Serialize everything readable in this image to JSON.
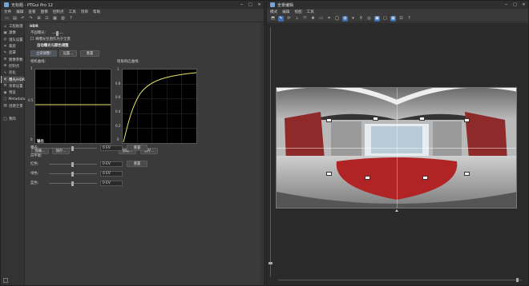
{
  "left_window": {
    "title": "无标题 - PTGui Pro 12",
    "menu": [
      "文件",
      "编辑",
      "查看",
      "图像",
      "控制点",
      "工具",
      "项目",
      "帮助"
    ],
    "sidebar": [
      {
        "label": "工程助理",
        "icon": "assistant-icon"
      },
      {
        "label": "源像",
        "icon": "source-images-icon"
      },
      {
        "label": "镜头设置",
        "icon": "lens-settings-icon"
      },
      {
        "label": "裁剪",
        "icon": "crop-icon"
      },
      {
        "label": "遮罩",
        "icon": "mask-icon"
      },
      {
        "label": "图像参数",
        "icon": "image-parameters-icon"
      },
      {
        "label": "控制点",
        "icon": "control-points-icon"
      },
      {
        "label": "优化",
        "icon": "optimizer-icon"
      },
      {
        "label": "曝光/HDR",
        "icon": "exposure-hdr-icon"
      },
      {
        "label": "项目设置",
        "icon": "project-settings-icon"
      },
      {
        "label": "预览",
        "icon": "preview-icon"
      },
      {
        "label": "Metadata",
        "icon": "metadata-icon"
      },
      {
        "label": "创建全景",
        "icon": "create-panorama-icon"
      },
      {
        "label": "",
        "icon": ""
      },
      {
        "label": "我的",
        "icon": "user-icon"
      }
    ],
    "hdr": {
      "section_title": "HDR",
      "bracket_label": "不固曝光:",
      "true_hdr_label": "将曝光包围作为于全景",
      "auto_title": "自动曝光与颜色调整",
      "btn_auto": "立即调整!",
      "btn_settings": "设置...",
      "btn_reset": "重置",
      "camera_curve_label": "相机曲线:",
      "flare_curve_label": "暗角响应曲线:",
      "btn_load1": "加载...",
      "btn_save1": "保存...",
      "btn_load2": "加载...",
      "btn_save2": "保存...",
      "tick_1": "1",
      "tick_05": "0.5",
      "tick_0": "0",
      "tick_08": "0.8",
      "tick_06": "0.6",
      "tick_04": "0.4",
      "tick_02": "0.2",
      "tick_00": "0"
    },
    "output": {
      "section_title": "输出",
      "exposure_label": "曝光:",
      "exposure_value": "0 EV",
      "wb_label": "白平衡:",
      "red_label": "红色:",
      "red_value": "0 EV",
      "green_label": "绿色:",
      "green_value": "0 EV",
      "blue_label": "蓝色:",
      "blue_value": "0 EV",
      "btn_reset_exposure": "重置",
      "btn_reset_wb": "重置"
    }
  },
  "right_window": {
    "title": "全景编辑",
    "menu": [
      "模式",
      "编辑",
      "视图",
      "工具"
    ]
  },
  "colors": {
    "curve": "#e9e56a",
    "active_indicator": "#f0c000",
    "toolbar_active": "#3b6fb6"
  }
}
